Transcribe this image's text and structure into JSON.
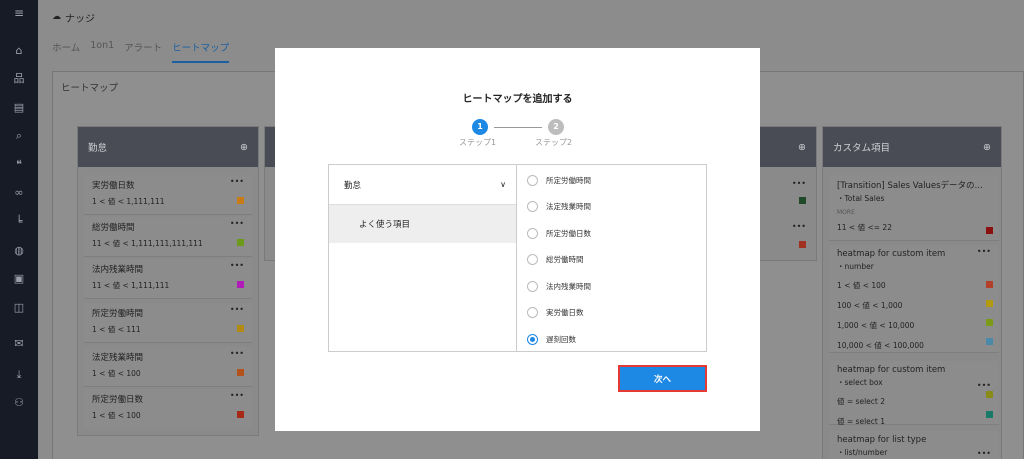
{
  "app": {
    "title": "ナッジ"
  },
  "sidebar": {
    "icons": [
      "menu-icon",
      "home-icon",
      "org-chart-icon",
      "document-icon",
      "search-icon",
      "chat-icon",
      "link-icon",
      "chart-icon",
      "globe-icon",
      "contact-icon",
      "book-icon",
      "mail-icon",
      "download-icon",
      "user-settings-icon"
    ]
  },
  "tabs": [
    {
      "label": "ホーム"
    },
    {
      "label": "1on1"
    },
    {
      "label": "アラート"
    },
    {
      "label": "ヒートマップ",
      "active": true
    }
  ],
  "section": {
    "title": "ヒートマップ"
  },
  "columns": [
    {
      "header": "勤怠",
      "cards": [
        {
          "title": "実労働日数",
          "range": "1 < 値 < 1,111,111",
          "color": "#c97c16"
        },
        {
          "title": "総労働時間",
          "range": "11 < 値 < 1,111,111,111,111",
          "color": "#6d9a1a"
        },
        {
          "title": "法内残業時間",
          "range": "11 < 値 < 1,111,111",
          "color": "#b01cb8"
        },
        {
          "title": "所定労働時間",
          "range": "1 < 値 < 111",
          "color": "#b38a11"
        },
        {
          "title": "法定残業時間",
          "range": "1 < 値 < 100",
          "color": "#b3521a"
        },
        {
          "title": "所定労働日数",
          "range": "1 < 値 < 100",
          "color": "#a62a16"
        }
      ]
    },
    {
      "header": "カスタム項目",
      "cards": [
        {
          "title": "[Transition] Sales Valuesデータの…",
          "sub": "・Total Sales",
          "tag": "MORE",
          "ranges": [
            {
              "range": "11 < 値 <= 22",
              "color": "#8a1010"
            }
          ]
        },
        {
          "title": "heatmap for custom item",
          "sub": "・number",
          "ranges": [
            {
              "range": "1 < 値 < 100",
              "color": "#b3402a"
            },
            {
              "range": "100 < 値 < 1,000",
              "color": "#b39a10"
            },
            {
              "range": "1,000 < 値 < 10,000",
              "color": "#7a9a18"
            },
            {
              "range": "10,000 < 値 < 100,000",
              "color": "#4a8aa8"
            }
          ]
        },
        {
          "title": "heatmap for custom item",
          "sub": "・select box",
          "ranges": [
            {
              "range": "値 = select 2",
              "color": "#8a8a18"
            },
            {
              "range": "値 = select 1",
              "color": "#1a7a6a"
            }
          ]
        },
        {
          "title": "heatmap for list type",
          "sub": "・list/number",
          "ranges": []
        }
      ]
    }
  ],
  "middle_columns": [
    {
      "colors": [
        "#1f4a2a",
        "#a03020"
      ]
    }
  ],
  "modal": {
    "title": "ヒートマップを追加する",
    "steps": [
      {
        "number": "1",
        "label": "ステップ1",
        "active": true
      },
      {
        "number": "2",
        "label": "ステップ2",
        "active": false
      }
    ],
    "category": {
      "label": "勤怠"
    },
    "subcategory": {
      "label": "よく使う項目"
    },
    "options": [
      {
        "label": "所定労働時間",
        "checked": false
      },
      {
        "label": "法定残業時間",
        "checked": false
      },
      {
        "label": "所定労働日数",
        "checked": false
      },
      {
        "label": "総労働時間",
        "checked": false
      },
      {
        "label": "法内残業時間",
        "checked": false
      },
      {
        "label": "実労働日数",
        "checked": false
      },
      {
        "label": "遅刻回数",
        "checked": true
      }
    ],
    "next_label": "次へ"
  },
  "colors": {
    "accent": "#1e88e5",
    "highlight": "#e53935",
    "header_bg": "#4a4c55"
  }
}
